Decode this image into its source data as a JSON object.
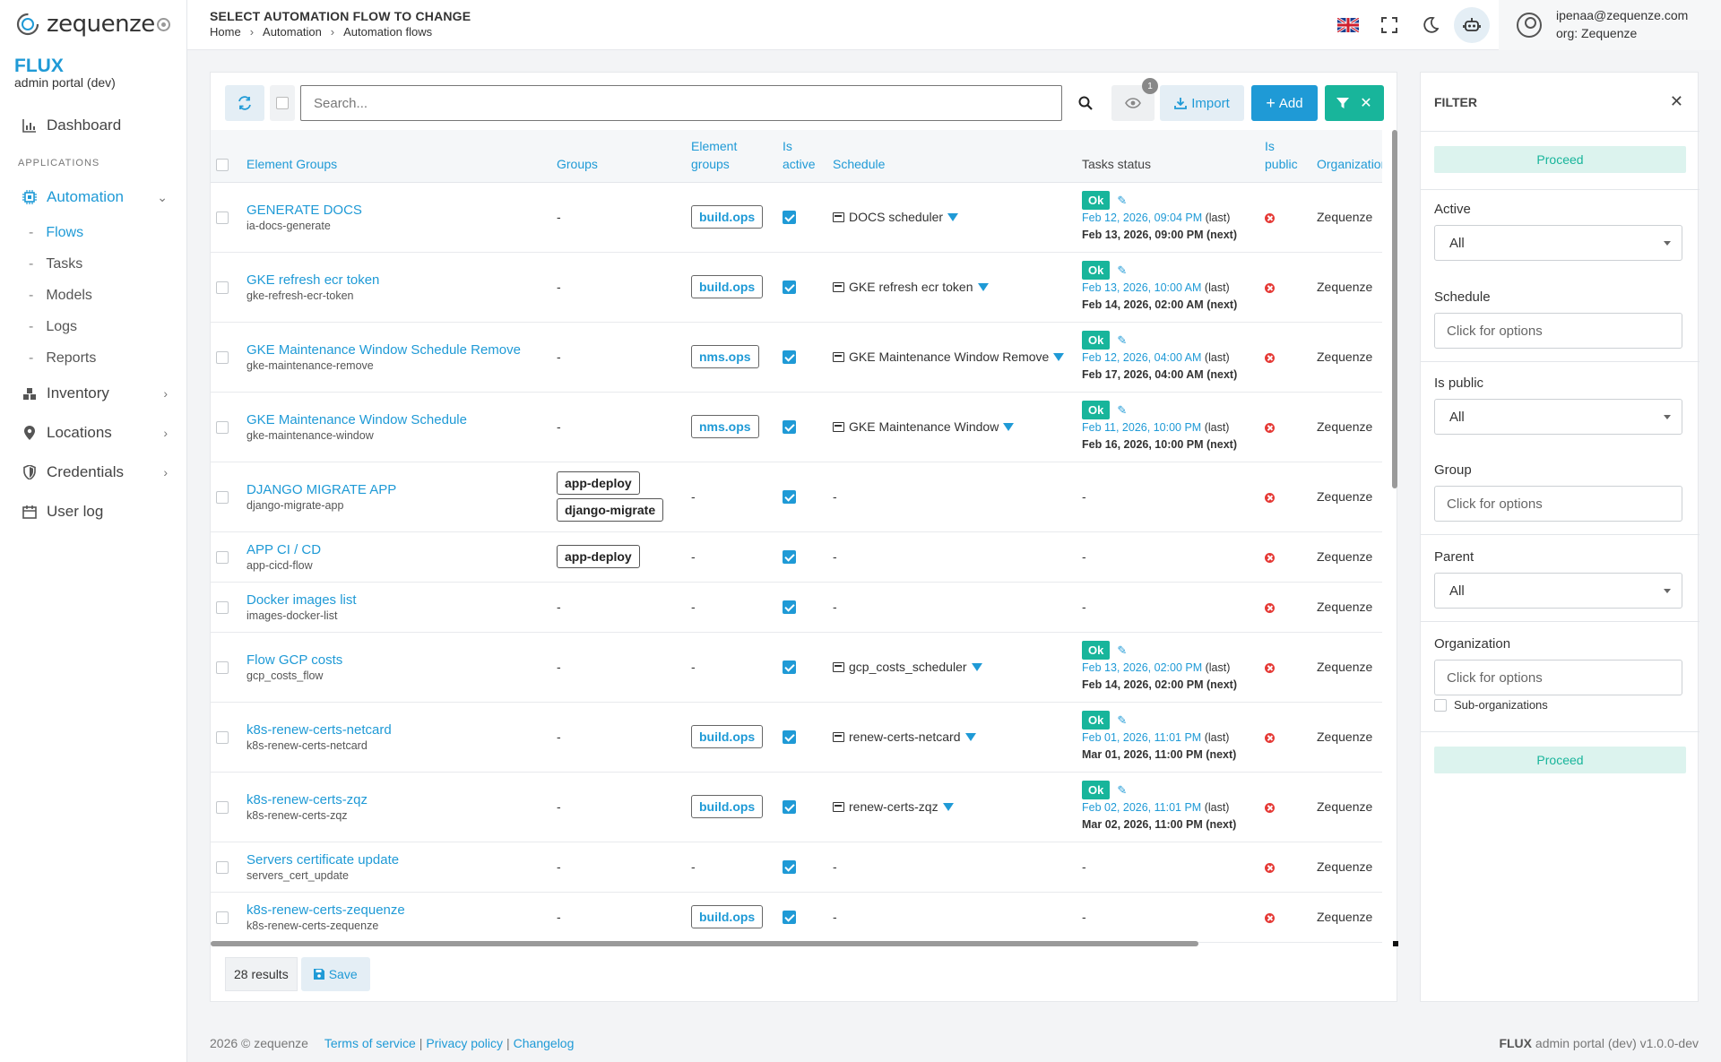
{
  "logo": {
    "text": "zequenze"
  },
  "brand": {
    "name": "FLUX",
    "subtitle": "admin portal (dev)"
  },
  "sidebar": {
    "dashboard": "Dashboard",
    "section": "APPLICATIONS",
    "automation": "Automation",
    "sub_items": [
      "Flows",
      "Tasks",
      "Models",
      "Logs",
      "Reports"
    ],
    "inventory": "Inventory",
    "locations": "Locations",
    "credentials": "Credentials",
    "user_log": "User log"
  },
  "header": {
    "title": "SELECT AUTOMATION FLOW TO CHANGE",
    "breadcrumb": [
      "Home",
      "Automation",
      "Automation flows"
    ]
  },
  "user": {
    "email": "ipenaa@zequenze.com",
    "org": "org: Zequenze"
  },
  "toolbar": {
    "search_placeholder": "Search...",
    "eye_badge": "1",
    "import_label": "Import",
    "add_label": "Add"
  },
  "table": {
    "headers": {
      "element_groups": "Element Groups",
      "groups": "Groups",
      "element_groups_col": "Element groups",
      "is_active": "Is active",
      "schedule": "Schedule",
      "tasks_status": "Tasks status",
      "is_public": "Is public",
      "organization": "Organization"
    },
    "rows": [
      {
        "name": "GENERATE DOCS",
        "slug": "ia-docs-generate",
        "groups": [
          "-"
        ],
        "element_group": "build.ops",
        "schedule": "DOCS scheduler",
        "status": "Ok",
        "last": "Feb 12, 2026, 09:04 PM",
        "next": "Feb 13, 2026, 09:00 PM",
        "org": "Zequenze"
      },
      {
        "name": "GKE refresh ecr token",
        "slug": "gke-refresh-ecr-token",
        "groups": [
          "-"
        ],
        "element_group": "build.ops",
        "schedule": "GKE refresh ecr token",
        "status": "Ok",
        "last": "Feb 13, 2026, 10:00 AM",
        "next": "Feb 14, 2026, 02:00 AM",
        "org": "Zequenze"
      },
      {
        "name": "GKE Maintenance Window Schedule Remove",
        "slug": "gke-maintenance-remove",
        "groups": [
          "-"
        ],
        "element_group": "nms.ops",
        "schedule": "GKE Maintenance Window Remove",
        "status": "Ok",
        "last": "Feb 12, 2026, 04:00 AM",
        "next": "Feb 17, 2026, 04:00 AM",
        "org": "Zequenze"
      },
      {
        "name": "GKE Maintenance Window Schedule",
        "slug": "gke-maintenance-window",
        "groups": [
          "-"
        ],
        "element_group": "nms.ops",
        "schedule": "GKE Maintenance Window",
        "status": "Ok",
        "last": "Feb 11, 2026, 10:00 PM",
        "next": "Feb 16, 2026, 10:00 PM",
        "org": "Zequenze"
      },
      {
        "name": "DJANGO MIGRATE APP",
        "slug": "django-migrate-app",
        "groups": [
          "app-deploy",
          "django-migrate"
        ],
        "element_group": "-",
        "schedule": "-",
        "status": "-",
        "last": "",
        "next": "",
        "org": "Zequenze"
      },
      {
        "name": "APP CI / CD",
        "slug": "app-cicd-flow",
        "groups": [
          "app-deploy"
        ],
        "element_group": "-",
        "schedule": "-",
        "status": "-",
        "last": "",
        "next": "",
        "org": "Zequenze"
      },
      {
        "name": "Docker images list",
        "slug": "images-docker-list",
        "groups": [
          "-"
        ],
        "element_group": "-",
        "schedule": "-",
        "status": "-",
        "last": "",
        "next": "",
        "org": "Zequenze"
      },
      {
        "name": "Flow GCP costs",
        "slug": "gcp_costs_flow",
        "groups": [
          "-"
        ],
        "element_group": "-",
        "schedule": "gcp_costs_scheduler",
        "status": "Ok",
        "last": "Feb 13, 2026, 02:00 PM",
        "next": "Feb 14, 2026, 02:00 PM",
        "org": "Zequenze"
      },
      {
        "name": "k8s-renew-certs-netcard",
        "slug": "k8s-renew-certs-netcard",
        "groups": [
          "-"
        ],
        "element_group": "build.ops",
        "schedule": "renew-certs-netcard",
        "status": "Ok",
        "last": "Feb 01, 2026, 11:01 PM",
        "next": "Mar 01, 2026, 11:00 PM",
        "org": "Zequenze"
      },
      {
        "name": "k8s-renew-certs-zqz",
        "slug": "k8s-renew-certs-zqz",
        "groups": [
          "-"
        ],
        "element_group": "build.ops",
        "schedule": "renew-certs-zqz",
        "status": "Ok",
        "last": "Feb 02, 2026, 11:01 PM",
        "next": "Mar 02, 2026, 11:00 PM",
        "org": "Zequenze"
      },
      {
        "name": "Servers certificate update",
        "slug": "servers_cert_update",
        "groups": [
          "-"
        ],
        "element_group": "-",
        "schedule": "-",
        "status": "-",
        "last": "",
        "next": "",
        "org": "Zequenze"
      },
      {
        "name": "k8s-renew-certs-zequenze",
        "slug": "k8s-renew-certs-zequenze",
        "groups": [
          "-"
        ],
        "element_group": "build.ops",
        "schedule": "-",
        "status": "-",
        "last": "",
        "next": "",
        "org": "Zequenze"
      }
    ],
    "last_suffix": "(last)",
    "next_suffix": "(next)"
  },
  "footer_bar": {
    "results": "28 results",
    "save": "Save"
  },
  "filter": {
    "title": "FILTER",
    "proceed": "Proceed",
    "active_label": "Active",
    "active_value": "All",
    "schedule_label": "Schedule",
    "schedule_placeholder": "Click for options",
    "public_label": "Is public",
    "public_value": "All",
    "group_label": "Group",
    "group_placeholder": "Click for options",
    "parent_label": "Parent",
    "parent_value": "All",
    "org_label": "Organization",
    "org_placeholder": "Click for options",
    "sub_orgs": "Sub-organizations"
  },
  "footer": {
    "copyright": "2026 © zequenze",
    "links": [
      "Terms of service",
      "Privacy policy",
      "Changelog"
    ],
    "product": "FLUX",
    "version": "admin portal (dev) v1.0.0-dev"
  },
  "colors": {
    "accent": "#1f9ad6",
    "success": "#18b59b",
    "danger": "#e53935"
  }
}
